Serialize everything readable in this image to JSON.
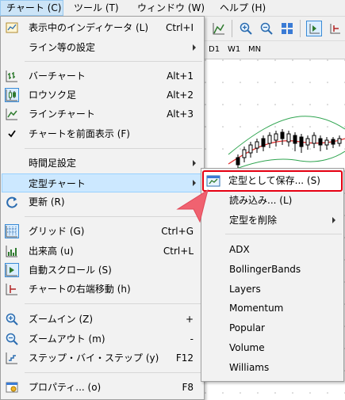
{
  "menubar": {
    "items": [
      {
        "label": "チャート (C)"
      },
      {
        "label": "ツール (T)"
      },
      {
        "label": "ウィンドウ (W)"
      },
      {
        "label": "ヘルプ (H)"
      }
    ]
  },
  "timeframes": [
    "D1",
    "W1",
    "MN"
  ],
  "menu": {
    "items": [
      {
        "label": "表示中のインディケータ (L)",
        "shortcut": "Ctrl+I",
        "icon": "indicator-list-icon"
      },
      {
        "label": "ライン等の設定",
        "submenu": true
      },
      {
        "label": "バーチャート",
        "shortcut": "Alt+1",
        "icon": "bar-chart-icon"
      },
      {
        "label": "ロウソク足",
        "shortcut": "Alt+2",
        "icon": "candlestick-icon"
      },
      {
        "label": "ラインチャート",
        "shortcut": "Alt+3",
        "icon": "line-chart-icon"
      },
      {
        "label": "チャートを前面表示 (F)",
        "icon": "checkmark-icon"
      },
      {
        "label": "時間足設定",
        "submenu": true
      },
      {
        "label": "定型チャート",
        "submenu": true
      },
      {
        "label": "更新 (R)",
        "icon": "refresh-icon"
      },
      {
        "label": "グリッド (G)",
        "shortcut": "Ctrl+G",
        "icon": "grid-icon"
      },
      {
        "label": "出来高 (u)",
        "shortcut": "Ctrl+L",
        "icon": "volume-icon"
      },
      {
        "label": "自動スクロール (S)",
        "icon": "auto-scroll-icon"
      },
      {
        "label": "チャートの右端移動 (h)",
        "icon": "chart-shift-icon"
      },
      {
        "label": "ズームイン (Z)",
        "shortcut": "+",
        "icon": "zoom-in-icon"
      },
      {
        "label": "ズームアウト (m)",
        "shortcut": "-",
        "icon": "zoom-out-icon"
      },
      {
        "label": "ステップ・バイ・ステップ (y)",
        "shortcut": "F12",
        "icon": "step-icon"
      },
      {
        "label": "プロパティ... (o)",
        "shortcut": "F8",
        "icon": "properties-icon"
      }
    ]
  },
  "submenu": {
    "items": [
      {
        "label": "定型として保存... (S)",
        "icon": "save-template-icon"
      },
      {
        "label": "読み込み... (L)"
      },
      {
        "label": "定型を削除",
        "submenu": true
      },
      {
        "label": "ADX"
      },
      {
        "label": "BollingerBands"
      },
      {
        "label": "Layers"
      },
      {
        "label": "Momentum"
      },
      {
        "label": "Popular"
      },
      {
        "label": "Volume"
      },
      {
        "label": "Williams"
      }
    ]
  },
  "colors": {
    "highlight_border": "#e60012",
    "callout_arrow": "#f06270",
    "selected_bg": "#cce8ff"
  }
}
